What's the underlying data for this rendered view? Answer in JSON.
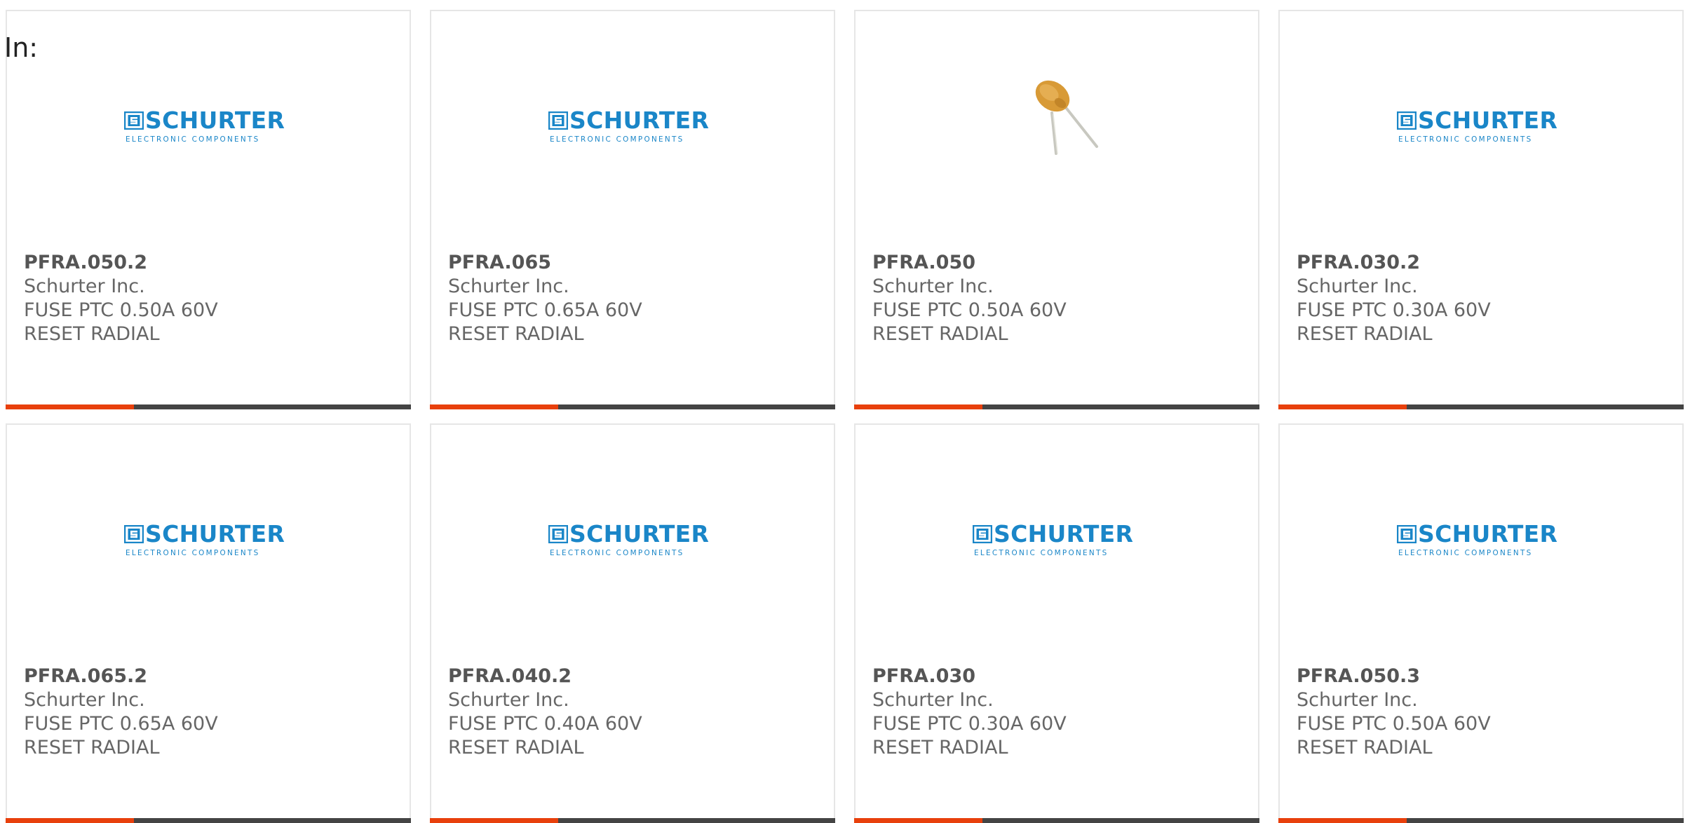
{
  "filter": {
    "label": "In:"
  },
  "brand": {
    "wordmark": "SCHURTER",
    "tagline": "ELECTRONIC COMPONENTS",
    "color": "#1a86c8"
  },
  "colors": {
    "accent": "#e8400c",
    "bar": "#444444",
    "text": "#666666"
  },
  "products": [
    {
      "part_number": "PFRA.050.2",
      "manufacturer": "Schurter Inc.",
      "description": "FUSE PTC 0.50A 60V RESET RADIAL",
      "image": "schurter-logo"
    },
    {
      "part_number": "PFRA.065",
      "manufacturer": "Schurter Inc.",
      "description": "FUSE PTC 0.65A 60V RESET RADIAL",
      "image": "schurter-logo"
    },
    {
      "part_number": "PFRA.050",
      "manufacturer": "Schurter Inc.",
      "description": "FUSE PTC 0.50A 60V RESET RADIAL",
      "image": "radial-ptc-fuse-photo"
    },
    {
      "part_number": "PFRA.030.2",
      "manufacturer": "Schurter Inc.",
      "description": "FUSE PTC 0.30A 60V RESET RADIAL",
      "image": "schurter-logo"
    },
    {
      "part_number": "PFRA.065.2",
      "manufacturer": "Schurter Inc.",
      "description": "FUSE PTC 0.65A 60V RESET RADIAL",
      "image": "schurter-logo"
    },
    {
      "part_number": "PFRA.040.2",
      "manufacturer": "Schurter Inc.",
      "description": "FUSE PTC 0.40A 60V RESET RADIAL",
      "image": "schurter-logo"
    },
    {
      "part_number": "PFRA.030",
      "manufacturer": "Schurter Inc.",
      "description": "FUSE PTC 0.30A 60V RESET RADIAL",
      "image": "schurter-logo"
    },
    {
      "part_number": "PFRA.050.3",
      "manufacturer": "Schurter Inc.",
      "description": "FUSE PTC 0.50A 60V RESET RADIAL",
      "image": "schurter-logo"
    }
  ]
}
